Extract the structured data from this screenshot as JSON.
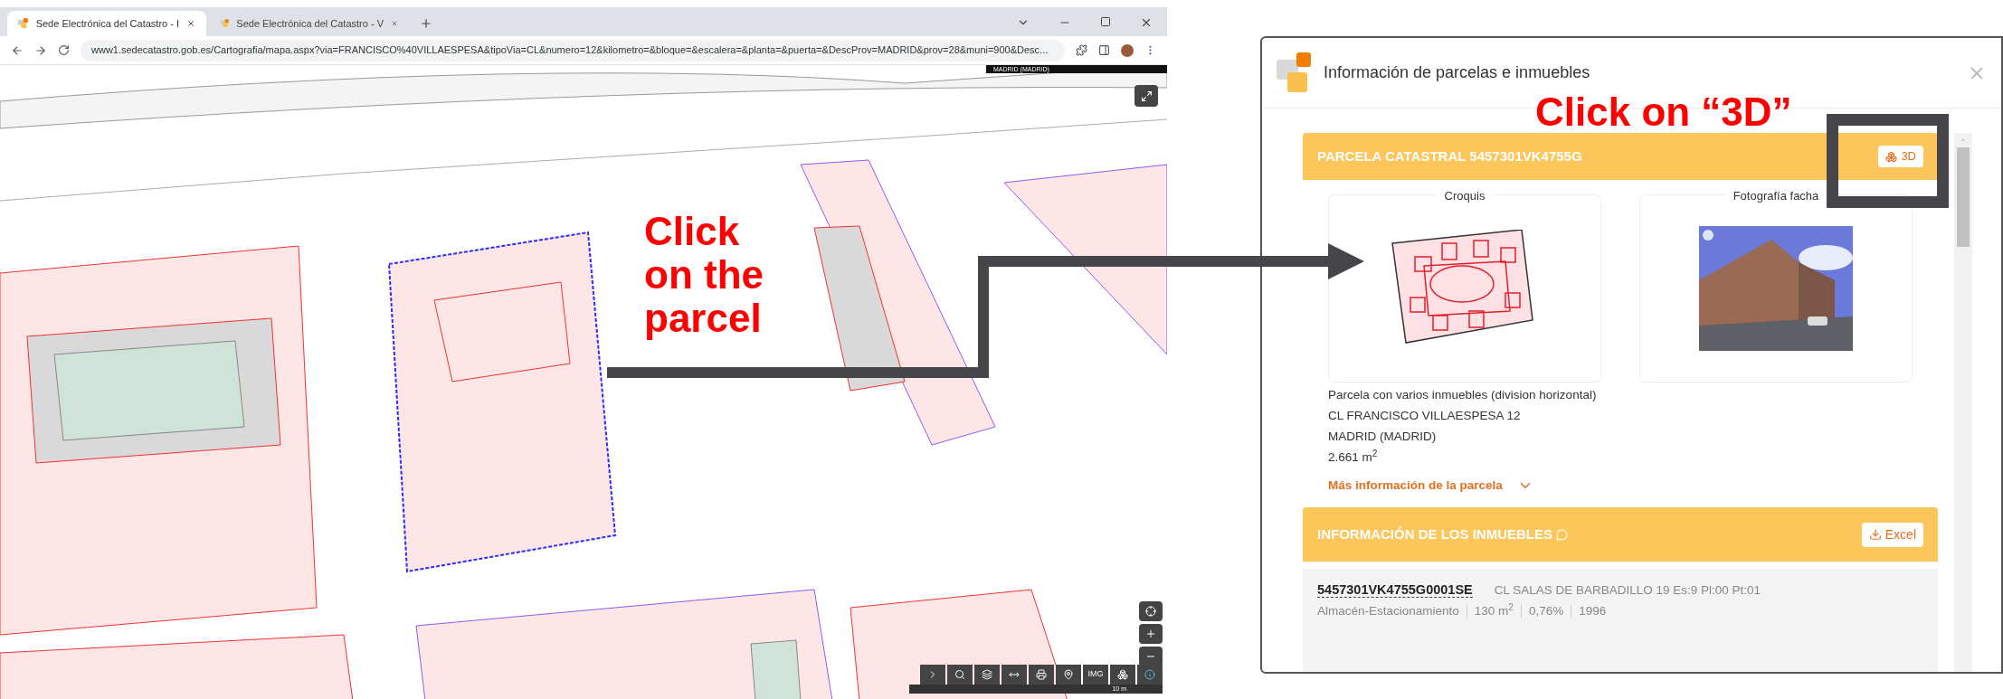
{
  "browser": {
    "tabs": [
      {
        "title": "Sede Electrónica del Catastro - I",
        "selected": true
      },
      {
        "title": "Sede Electrónica del Catastro - V",
        "selected": false
      }
    ],
    "url": "www1.sedecatastro.gob.es/Cartografia/mapa.aspx?via=FRANCISCO%40VILLAESPESA&tipoVia=CL&numero=12&kilometro=&bloque=&escalera=&planta=&puerta=&DescProv=MADRID&prov=28&muni=900&Desc..."
  },
  "map": {
    "location_label": "MADRID (MADRID)",
    "img_button": "IMG",
    "scale": "10 m"
  },
  "panel": {
    "title": "Información de parcelas e inmuebles",
    "parcel": {
      "header": "PARCELA CATASTRAL 5457301VK4755G",
      "button": "3D",
      "sketch_label": "Croquis",
      "photo_label": "Fotografía facha",
      "description": [
        "Parcela con varios inmuebles (division horizontal)",
        "CL FRANCISCO VILLAESPESA 12",
        "MADRID (MADRID)",
        "2.661 m$^{2}$"
      ],
      "more_link": "Más información de la parcela"
    },
    "properties": {
      "header": "INFORMACIÓN DE LOS INMUEBLES",
      "button": "Excel",
      "rows": [
        {
          "reference": "5457301VK4755G0001SE",
          "address": "CL SALAS DE BARBADILLO 19 Es:9 Pl:00 Pt:01",
          "details": [
            "Almacén-Estacionamiento",
            "130 m$^{2}$",
            "0,76%",
            "1996"
          ]
        }
      ]
    }
  },
  "annotations": [
    {
      "text": "Click on the parcel"
    },
    {
      "text": "Click on “3D”"
    }
  ]
}
